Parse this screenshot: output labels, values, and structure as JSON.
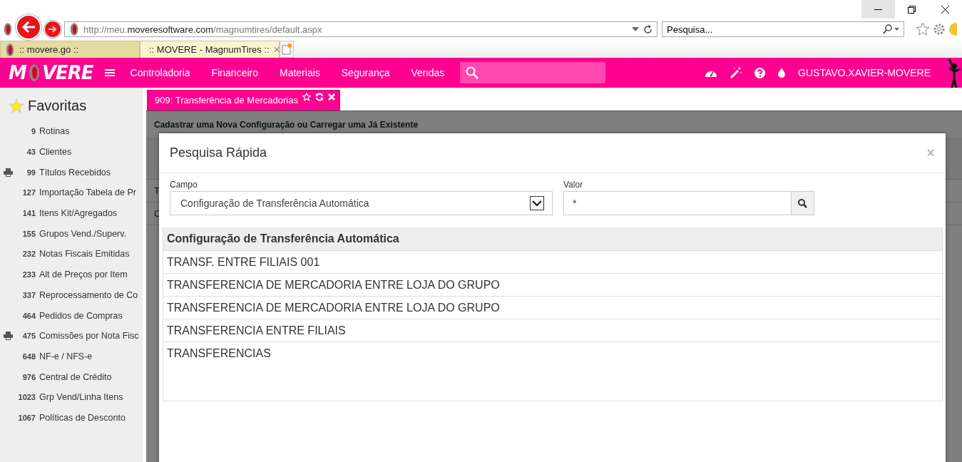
{
  "browser": {
    "address": "http://meu.**moveresoftware.com**/magnumtires/default.aspx",
    "search": {
      "placeholder": "Pesquisa..."
    },
    "tabs": [
      {
        "label": ":: movere.go ::",
        "selected": false
      },
      {
        "label": ":: MOVERE - MagnumTires ::",
        "selected": true,
        "close": "×"
      }
    ]
  },
  "app": {
    "logo": {
      "before": "M",
      "after": "VERE"
    },
    "menu": [
      "Controladoria",
      "Financeiro",
      "Materiais",
      "Segurança",
      "Vendas"
    ],
    "user": "GUSTAVO.XAVIER-MOVERE"
  },
  "sidebar": {
    "title": "Favoritas",
    "items": [
      {
        "number": "9",
        "label": "Rotinas",
        "printable": false
      },
      {
        "number": "43",
        "label": "Clientes",
        "printable": false
      },
      {
        "number": "99",
        "label": "Títulos Recebidos",
        "printable": true
      },
      {
        "number": "127",
        "label": "Importação Tabela de Pr",
        "printable": false
      },
      {
        "number": "141",
        "label": "Itens Kit/Agregados",
        "printable": false
      },
      {
        "number": "155",
        "label": "Grupos Vend./Superv.",
        "printable": false
      },
      {
        "number": "232",
        "label": "Notas Fiscais Emitidas",
        "printable": false
      },
      {
        "number": "233",
        "label": "Alt de Preços por Item",
        "printable": false
      },
      {
        "number": "337",
        "label": "Reprocessamento de Co",
        "printable": false
      },
      {
        "number": "464",
        "label": "Pedidos de Compras",
        "printable": false
      },
      {
        "number": "475",
        "label": "Comissões por Nota Fisc",
        "printable": true
      },
      {
        "number": "648",
        "label": "NF-e / NFS-e",
        "printable": false
      },
      {
        "number": "976",
        "label": "Central de Crédito",
        "printable": false
      },
      {
        "number": "1023",
        "label": "Grp Vend/Linha Itens",
        "printable": false
      },
      {
        "number": "1067",
        "label": "Políticas de Desconto",
        "printable": false
      }
    ]
  },
  "page_tab": {
    "title": "909: Transferência de Mercadorias"
  },
  "page": {
    "heading": "Cadastrar uma Nova Configuração ou Carregar uma Já Existente",
    "row_labels": [
      "T",
      "C"
    ]
  },
  "modal": {
    "title": "Pesquisa Rápida",
    "close": "×",
    "campo": {
      "label": "Campo",
      "value": "Configuração de Transferência Automática"
    },
    "valor": {
      "label": "Valor",
      "value": "*"
    },
    "table": {
      "columns": [
        "Configuração de Transferência Automática"
      ],
      "rows": [
        "TRANSF. ENTRE FILIAIS 001",
        "TRANSFERENCIA DE MERCADORIA ENTRE LOJA DO GRUPO",
        "TRANSFERENCIA DE MERCADORIA ENTRE LOJA DO GRUPO",
        "TRANSFERENCIA ENTRE FILIAIS",
        "TRANSFERENCIAS"
      ]
    }
  }
}
